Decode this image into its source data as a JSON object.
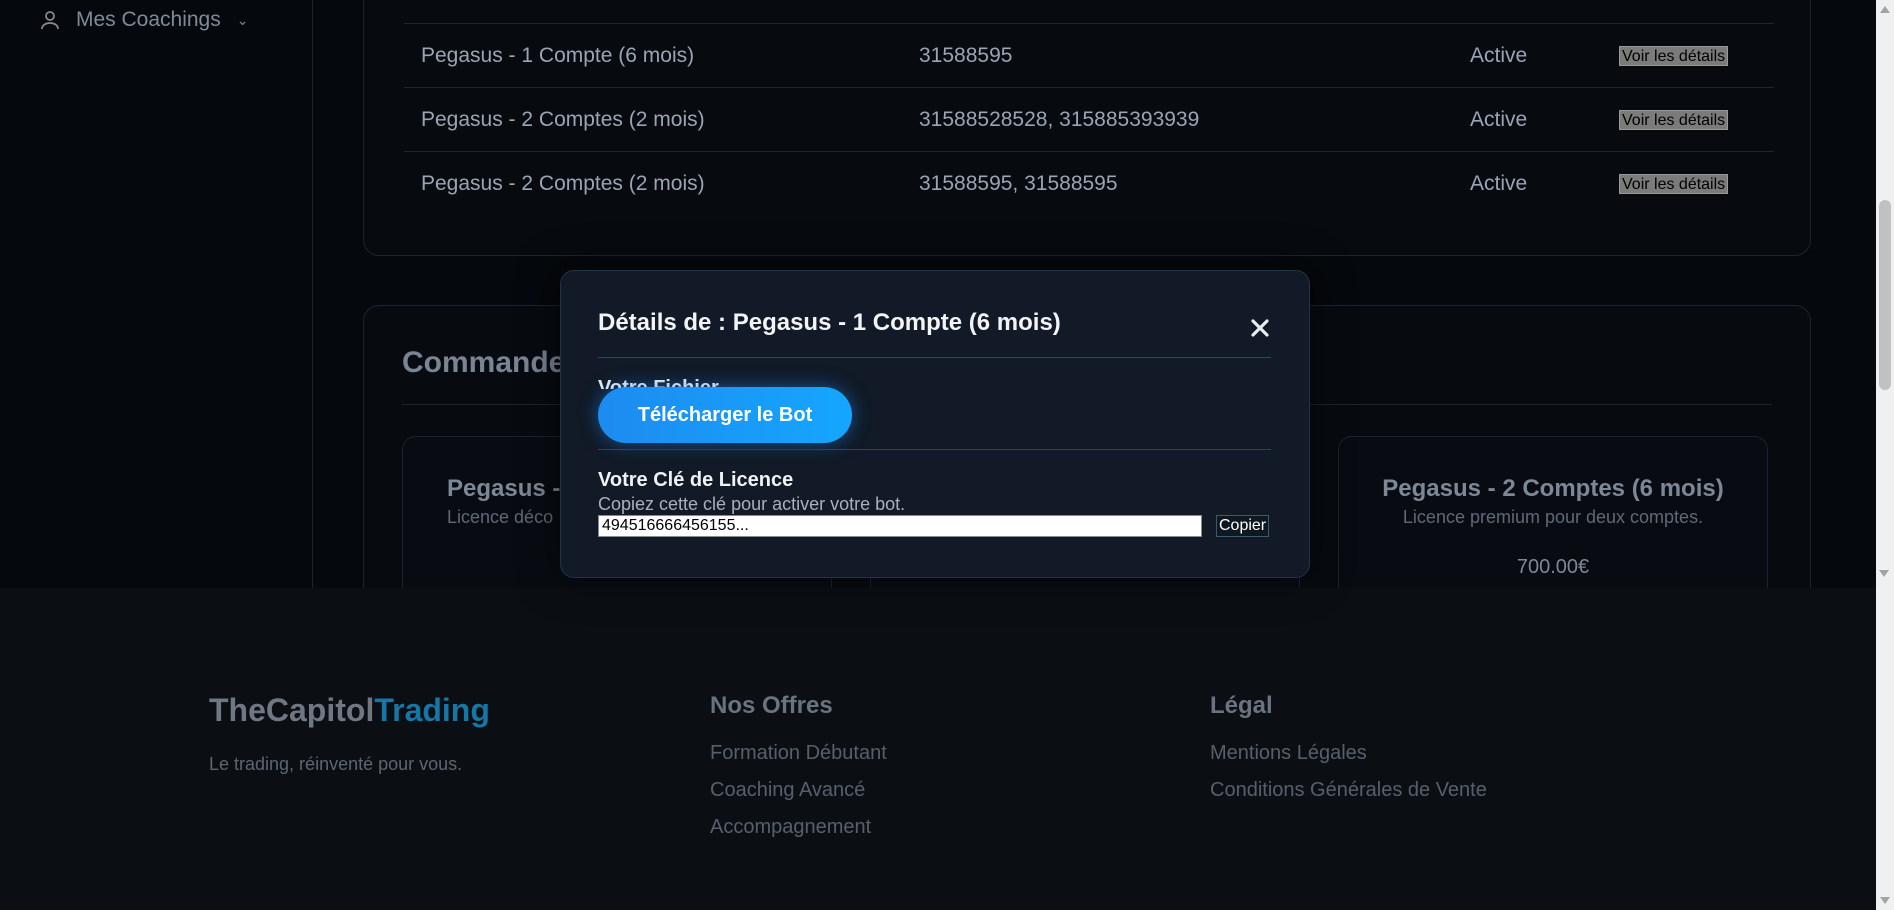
{
  "sidebar": {
    "items": [
      {
        "label": "Mes Coachings",
        "icon": "user-icon"
      }
    ]
  },
  "subscriptions": {
    "rows": [
      {
        "name": "Pegasus - 1 Compte (6 mois)",
        "accounts": "31588595",
        "status": "Active",
        "action": "Voir les détails"
      },
      {
        "name": "Pegasus - 2 Comptes (2 mois)",
        "accounts": "31588528528, 315885393939",
        "status": "Active",
        "action": "Voir les détails"
      },
      {
        "name": "Pegasus - 2 Comptes (2 mois)",
        "accounts": "31588595, 31588595",
        "status": "Active",
        "action": "Voir les détails"
      }
    ]
  },
  "orders": {
    "title": "Commande",
    "offers": [
      {
        "title": "Pegasus -",
        "desc": "Licence déco"
      },
      {
        "title": "",
        "desc": ""
      },
      {
        "title": "Pegasus - 2 Comptes (6 mois)",
        "desc": "Licence premium pour deux comptes.",
        "price": "700.00€"
      }
    ]
  },
  "modal": {
    "title": "Détails de : Pegasus - 1 Compte (6 mois)",
    "close_icon": "close-icon",
    "file_label": "Votre Fichier",
    "download_label": "Télécharger le Bot",
    "license_label": "Votre Clé de Licence",
    "license_help": "Copiez cette clé pour activer votre bot.",
    "license_value": "494516666456155...",
    "copy_label": "Copier"
  },
  "footer": {
    "brand_main": "TheCapitol",
    "brand_accent": "Trading",
    "tagline": "Le trading, réinventé pour vous.",
    "offres": {
      "title": "Nos Offres",
      "links": [
        "Formation Débutant",
        "Coaching Avancé",
        "Accompagnement"
      ]
    },
    "legal": {
      "title": "Légal",
      "links": [
        "Mentions Légales",
        "Conditions Générales de Vente"
      ]
    }
  },
  "colors": {
    "accent": "#1d8bf0",
    "brand_accent": "#1676a5",
    "background": "#05080c"
  }
}
